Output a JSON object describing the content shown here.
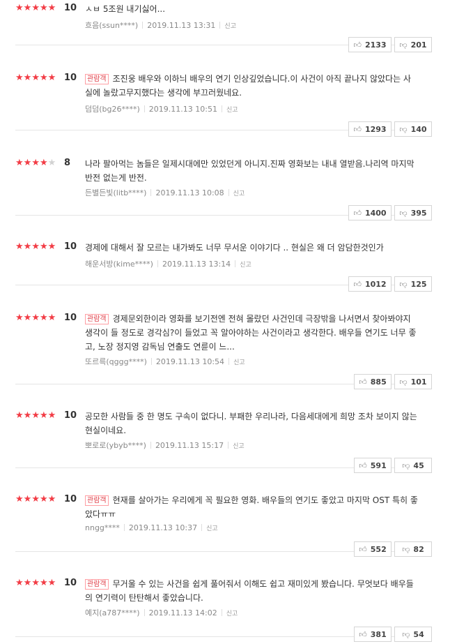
{
  "colors": {
    "star": "#f23c45",
    "star_empty": "#d2d2d2",
    "badge": "#e0424b"
  },
  "icons": {
    "like": "thumbs-up-icon",
    "dislike": "thumbs-down-icon",
    "star": "star-icon"
  },
  "reviews": [
    {
      "stars": 5,
      "score": "10",
      "badge": "",
      "text": "ㅅㅂ 5조원 내기싫어...",
      "user": "흐음(ssun****)",
      "date": "2019.11.13 13:31",
      "report": "신고",
      "likes": "2133",
      "dislikes": "201"
    },
    {
      "stars": 5,
      "score": "10",
      "badge": "관람객",
      "text": "조진웅 배우와 이하늬 배우의 연기 인상깊었습니다.이 사건이 아직 끝나지 않았다는 사실에 놀랐고무지했다는 생각에 부끄러웠네요.",
      "user": "덤덤(bg26****)",
      "date": "2019.11.13 10:51",
      "report": "신고",
      "likes": "1293",
      "dislikes": "140"
    },
    {
      "stars": 4,
      "score": "8",
      "badge": "",
      "text": "나라 팔아먹는 놈들은 일제시대에만 있었던게 아니지.진짜 영화보는 내내 열받음.나리역 마지막 반전 없는게 반전.",
      "user": "든별든빛(litb****)",
      "date": "2019.11.13 10:08",
      "report": "신고",
      "likes": "1400",
      "dislikes": "395"
    },
    {
      "stars": 5,
      "score": "10",
      "badge": "",
      "text": "경제에 대해서 잘 모르는 내가봐도 너무 무서운 이야기다 .. 현실은 왜 더 암담한것인가",
      "user": "해운서방(kime****)",
      "date": "2019.11.13 13:14",
      "report": "신고",
      "likes": "1012",
      "dislikes": "125"
    },
    {
      "stars": 5,
      "score": "10",
      "badge": "관람객",
      "text": "경제문외한이라 영화를 보기전엔 전혀 몰랐던 사건인데 극장밖을 나서면서 찾아봐야지 생각이 들 정도로 경각심?이 들었고 꼭 알아야하는 사건이라고 생각한다. 배우들 연기도 너무 좋고, 노장 정지영 감독님 연출도 연륜이 느...",
      "user": "또르륵(qggg****)",
      "date": "2019.11.13 10:54",
      "report": "신고",
      "likes": "885",
      "dislikes": "101"
    },
    {
      "stars": 5,
      "score": "10",
      "badge": "",
      "text": "공모한 사람들 중 한 명도 구속이 없다니. 부패한 우리나라, 다음세대에게 희망 조차 보이지 않는 현실이네요.",
      "user": "뽀로로(ybyb****)",
      "date": "2019.11.13 15:17",
      "report": "신고",
      "likes": "591",
      "dislikes": "45"
    },
    {
      "stars": 5,
      "score": "10",
      "badge": "관람객",
      "text": "현재를 살아가는 우리에게 꼭 필요한 영화. 배우들의 연기도 좋았고 마지막 OST 특히 좋았다ㅠㅠ",
      "user": "nngg****",
      "date": "2019.11.13 10:37",
      "report": "신고",
      "likes": "552",
      "dislikes": "82"
    },
    {
      "stars": 5,
      "score": "10",
      "badge": "관람객",
      "text": "무거울 수 있는 사건을 쉽게 풀어줘서 이해도 쉽고 재미있게 봤습니다. 무엇보다 배우들의 연기력이 탄탄해서 좋았습니다.",
      "user": "예지(a787****)",
      "date": "2019.11.13 14:02",
      "report": "신고",
      "likes": "381",
      "dislikes": "54"
    }
  ]
}
